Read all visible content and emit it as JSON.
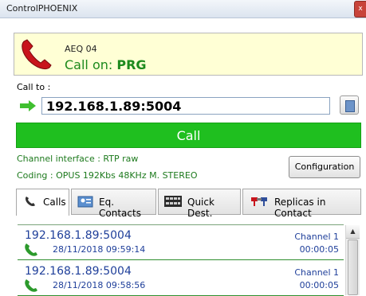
{
  "window": {
    "title": "ControlPHOENIX",
    "close_glyph": "x"
  },
  "status": {
    "device": "AEQ 04",
    "call_on_prefix": "Call on: ",
    "call_on_target": "PRG"
  },
  "call_to": {
    "label": "Call to :",
    "address": "192.168.1.89:5004"
  },
  "call_button": "Call",
  "info": {
    "channel_interface": "Channel interface : RTP raw",
    "coding": "Coding : OPUS 192Kbs 48KHz M. STEREO"
  },
  "configuration_button": "Configuration",
  "tabs": [
    {
      "label": "Calls",
      "icon": "phone-icon"
    },
    {
      "label": "Eq. Contacts",
      "icon": "contacts-icon"
    },
    {
      "label": "Quick Dest.",
      "icon": "keypad-icon"
    },
    {
      "label": "Replicas in Contact",
      "icon": "replica-icon"
    }
  ],
  "calls": [
    {
      "address": "192.168.1.89:5004",
      "datetime": "28/11/2018 09:59:14",
      "channel": "Channel 1",
      "duration": "00:00:05"
    },
    {
      "address": "192.168.1.89:5004",
      "datetime": "28/11/2018 09:58:56",
      "channel": "Channel 1",
      "duration": "00:00:05"
    }
  ],
  "colors": {
    "call_green": "#1fbf1f",
    "status_bg": "#ffffd5",
    "link_blue": "#1f3f9a"
  }
}
